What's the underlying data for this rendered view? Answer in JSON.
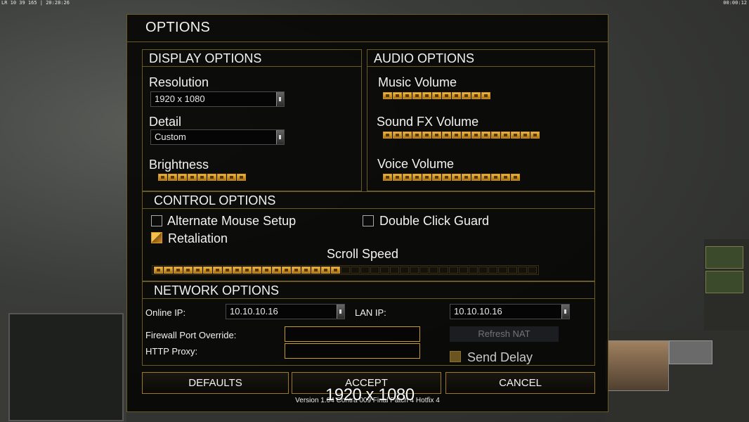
{
  "hud": {
    "left": "LR 10 39 165 | 20:28:26",
    "right": "00:00:12"
  },
  "dialog": {
    "title": "OPTIONS",
    "display": {
      "heading": "DISPLAY OPTIONS",
      "resolution_label": "Resolution",
      "resolution_value": "1920 x 1080",
      "detail_label": "Detail",
      "detail_value": "Custom",
      "brightness_label": "Brightness",
      "brightness_level": 9
    },
    "audio": {
      "heading": "AUDIO OPTIONS",
      "music_label": "Music Volume",
      "music_level": 11,
      "sfx_label": "Sound FX Volume",
      "sfx_level": 16,
      "voice_label": "Voice Volume",
      "voice_level": 14
    },
    "control": {
      "heading": "CONTROL OPTIONS",
      "alt_mouse_label": "Alternate Mouse Setup",
      "alt_mouse_checked": false,
      "double_click_label": "Double Click Guard",
      "double_click_checked": false,
      "retaliation_label": "Retaliation",
      "retaliation_checked": true,
      "scroll_label": "Scroll Speed",
      "scroll_level": 19,
      "scroll_max": 39
    },
    "network": {
      "heading": "NETWORK OPTIONS",
      "online_ip_label": "Online IP:",
      "online_ip_value": "10.10.10.16",
      "lan_ip_label": "LAN IP:",
      "lan_ip_value": "10.10.10.16",
      "firewall_label": "Firewall Port Override:",
      "firewall_value": "",
      "proxy_label": "HTTP Proxy:",
      "proxy_value": "",
      "refresh_label": "Refresh NAT",
      "send_delay_label": "Send Delay",
      "send_delay_checked": true
    },
    "buttons": {
      "defaults": "DEFAULTS",
      "accept": "ACCEPT",
      "cancel": "CANCEL"
    },
    "version": "Version 1.04 Contra 009 Final Patch 4 Hotfix 4",
    "overlay_text": "1920 x 1080"
  }
}
